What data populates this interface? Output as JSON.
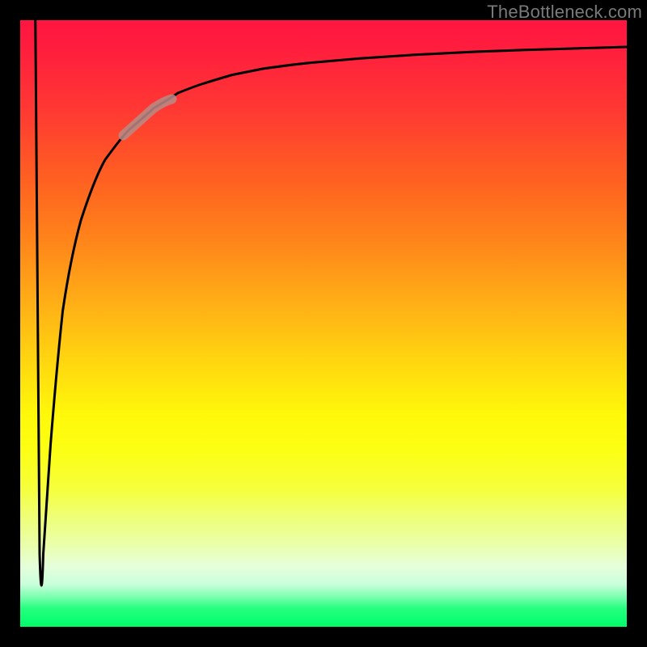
{
  "watermark": "TheBottleneck.com",
  "colors": {
    "frame": "#000000",
    "curve_stroke": "#000000",
    "highlight_stroke": "#b98b86",
    "watermark": "#7a7a7a"
  },
  "chart_data": {
    "type": "line",
    "title": "",
    "xlabel": "",
    "ylabel": "",
    "xlim": [
      0,
      100
    ],
    "ylim": [
      0,
      100
    ],
    "grid": false,
    "legend": false,
    "gradient_stops": [
      {
        "pos": 0.0,
        "color": "#ff1540"
      },
      {
        "pos": 0.04,
        "color": "#ff1c3e"
      },
      {
        "pos": 0.14,
        "color": "#ff3634"
      },
      {
        "pos": 0.27,
        "color": "#ff6320"
      },
      {
        "pos": 0.37,
        "color": "#ff871a"
      },
      {
        "pos": 0.47,
        "color": "#ffb016"
      },
      {
        "pos": 0.57,
        "color": "#ffd90f"
      },
      {
        "pos": 0.65,
        "color": "#fff80a"
      },
      {
        "pos": 0.71,
        "color": "#fcff14"
      },
      {
        "pos": 0.77,
        "color": "#f6ff3a"
      },
      {
        "pos": 0.82,
        "color": "#eeff78"
      },
      {
        "pos": 0.87,
        "color": "#e9ffb0"
      },
      {
        "pos": 0.9,
        "color": "#e6ffdb"
      },
      {
        "pos": 0.93,
        "color": "#c9ffdb"
      },
      {
        "pos": 0.95,
        "color": "#7dffb0"
      },
      {
        "pos": 0.97,
        "color": "#24ff7e"
      },
      {
        "pos": 1.0,
        "color": "#00ff6a"
      }
    ],
    "series": [
      {
        "name": "left-spike-down",
        "x": [
          2.5,
          3.5
        ],
        "values": [
          100,
          2
        ]
      },
      {
        "name": "main-curve",
        "x": [
          3.5,
          5,
          7,
          10,
          14,
          18,
          22,
          26,
          30,
          35,
          40,
          48,
          56,
          65,
          75,
          85,
          100
        ],
        "values": [
          2,
          30,
          52,
          67,
          77,
          82,
          85.5,
          88,
          89.5,
          91,
          92,
          93,
          93.7,
          94.3,
          94.8,
          95.2,
          95.6
        ]
      }
    ],
    "highlight_segment": {
      "series": "main-curve",
      "x_range": [
        17,
        25
      ],
      "y_range": [
        81,
        87
      ]
    }
  }
}
